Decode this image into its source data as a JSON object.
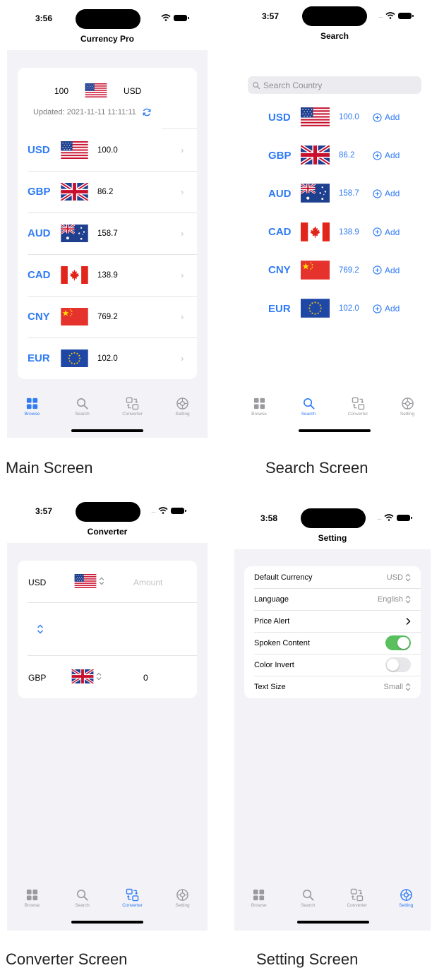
{
  "captions": {
    "main": "Main Screen",
    "search": "Search Screen",
    "converter": "Converter Screen",
    "setting": "Setting Screen"
  },
  "tabs": {
    "browse": "Browse",
    "search": "Search",
    "converter": "Converter",
    "setting": "Setting"
  },
  "main_screen": {
    "time": "3:56",
    "title": "Currency Pro",
    "base_amount": "100",
    "base_code": "USD",
    "updated": "Updated: 2021-11-11 11:11:11",
    "rows": [
      {
        "code": "USD",
        "value": "100.0"
      },
      {
        "code": "GBP",
        "value": "86.2"
      },
      {
        "code": "AUD",
        "value": "158.7"
      },
      {
        "code": "CAD",
        "value": "138.9"
      },
      {
        "code": "CNY",
        "value": "769.2"
      },
      {
        "code": "EUR",
        "value": "102.0"
      }
    ]
  },
  "search_screen": {
    "time": "3:57",
    "title": "Search",
    "placeholder": "Search Country",
    "add_label": "Add",
    "rows": [
      {
        "code": "USD",
        "value": "100.0"
      },
      {
        "code": "GBP",
        "value": "86.2"
      },
      {
        "code": "AUD",
        "value": "158.7"
      },
      {
        "code": "CAD",
        "value": "138.9"
      },
      {
        "code": "CNY",
        "value": "769.2"
      },
      {
        "code": "EUR",
        "value": "102.0"
      }
    ]
  },
  "converter_screen": {
    "time": "3:57",
    "title": "Converter",
    "from_code": "USD",
    "amount_placeholder": "Amount",
    "to_code": "GBP",
    "result": "0"
  },
  "setting_screen": {
    "time": "3:58",
    "title": "Setting",
    "rows": {
      "default_currency": {
        "label": "Default Currency",
        "value": "USD"
      },
      "language": {
        "label": "Language",
        "value": "English"
      },
      "price_alert": {
        "label": "Price Alert"
      },
      "spoken_content": {
        "label": "Spoken Content",
        "on": true
      },
      "color_invert": {
        "label": "Color Invert",
        "on": false
      },
      "text_size": {
        "label": "Text Size",
        "value": "Small"
      }
    }
  },
  "colors": {
    "accent": "#2f7bf5",
    "background": "#f2f2f7",
    "toggle_on": "#5ac05e"
  }
}
